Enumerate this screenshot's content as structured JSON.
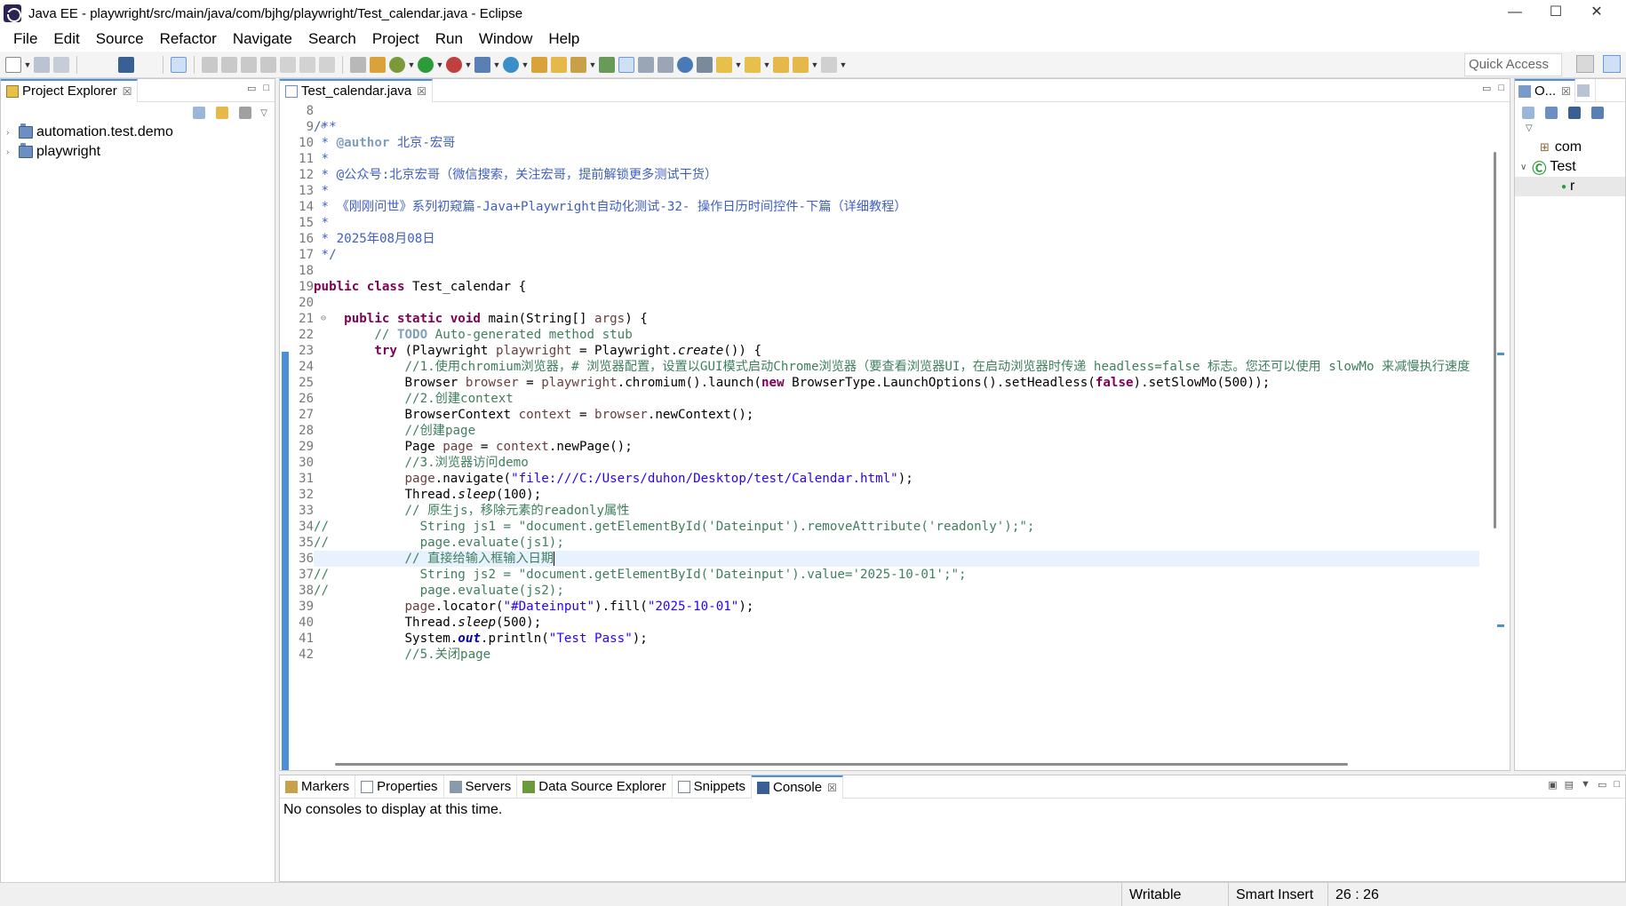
{
  "window": {
    "title": "Java EE - playwright/src/main/java/com/bjhg/playwright/Test_calendar.java - Eclipse",
    "controls": [
      "—",
      "☐",
      "✕"
    ]
  },
  "menu": [
    "File",
    "Edit",
    "Source",
    "Refactor",
    "Navigate",
    "Search",
    "Project",
    "Run",
    "Window",
    "Help"
  ],
  "toolbar": {
    "quick_access": "Quick Access"
  },
  "project_explorer": {
    "title": "Project Explorer",
    "close": "☒",
    "items": [
      {
        "label": "automation.test.demo"
      },
      {
        "label": "playwright"
      }
    ]
  },
  "editor": {
    "tab": "Test_calendar.java",
    "close": "☒",
    "line_numbers": [
      "8",
      "9",
      "10",
      "11",
      "12",
      "13",
      "14",
      "15",
      "16",
      "17",
      "18",
      "19",
      "20",
      "21",
      "22",
      "23",
      "24",
      "25",
      "26",
      "27",
      "28",
      "29",
      "30",
      "31",
      "32",
      "33",
      "34",
      "35",
      "36",
      "37",
      "38",
      "39",
      "40",
      "41",
      "42"
    ],
    "fold_markers": {
      "9": "⊖",
      "21": "⊖"
    },
    "text": {
      "l9": "/**",
      "l10_star": " * ",
      "l10_tag": "@author",
      "l10_rest": " 北京-宏哥",
      "l11": " *",
      "l12": " * @公众号:北京宏哥（微信搜索，关注宏哥，提前解锁更多测试干货）",
      "l13": " *",
      "l14": " * 《刚刚问世》系列初窥篇-Java+Playwright自动化测试-32- 操作日历时间控件-下篇（详细教程）",
      "l15": " *",
      "l16": " * 2025年08月08日",
      "l17": " */",
      "l19_kw": "public class",
      "l19_rest": " Test_calendar {",
      "l21_indent": "    ",
      "l21_kw": "public static void",
      "l21_rest": " main(String[] ",
      "l21_var": "args",
      "l21_end": ") {",
      "l22_indent": "        ",
      "l22_pre": "// ",
      "l22_todo": "TODO",
      "l22_rest": " Auto-generated method stub",
      "l23_indent": "        ",
      "l23_kw": "try",
      "l23_a": " (Playwright ",
      "l23_var": "playwright",
      "l23_b": " = Playwright.",
      "l23_m": "create",
      "l23_c": "()) {",
      "l24_indent": "            ",
      "l24": "//1.使用chromium浏览器，# 浏览器配置，设置以GUI模式启动Chrome浏览器（要查看浏览器UI，在启动浏览器时传递 headless=false 标志。您还可以使用 slowMo 来减慢执行速度",
      "l25_indent": "            ",
      "l25_a": "Browser ",
      "l25_var": "browser",
      "l25_b": " = ",
      "l25_var2": "playwright",
      "l25_c": ".chromium().launch(",
      "l25_kw": "new",
      "l25_d": " BrowserType.LaunchOptions().setHeadless(",
      "l25_kw2": "false",
      "l25_e": ").setSlowMo(500));",
      "l26_indent": "            ",
      "l26": "//2.创建context",
      "l27_indent": "            ",
      "l27_a": "BrowserContext ",
      "l27_var": "context",
      "l27_b": " = ",
      "l27_var2": "browser",
      "l27_c": ".newContext();",
      "l28_indent": "            ",
      "l28": "//创建page",
      "l29_indent": "            ",
      "l29_a": "Page ",
      "l29_var": "page",
      "l29_b": " = ",
      "l29_var2": "context",
      "l29_c": ".newPage();",
      "l30_indent": "            ",
      "l30": "//3.浏览器访问demo",
      "l31_indent": "            ",
      "l31_var": "page",
      "l31_a": ".navigate(",
      "l31_str": "\"file:///C:/Users/duhon/Desktop/test/Calendar.html\"",
      "l31_b": ");",
      "l32_indent": "            ",
      "l32_a": "Thread.",
      "l32_m": "sleep",
      "l32_b": "(100);",
      "l33_indent": "            ",
      "l33": "// 原生js，移除元素的readonly属性",
      "l34": "//            String js1 = \"document.getElementById('Dateinput').removeAttribute('readonly');\";",
      "l35": "//            page.evaluate(js1);",
      "l36_indent": "            ",
      "l36": "// 直接给输入框输入日期",
      "l37": "//            String js2 = \"document.getElementById('Dateinput').value='2025-10-01';\";",
      "l38": "//            page.evaluate(js2);",
      "l39_indent": "            ",
      "l39_var": "page",
      "l39_a": ".locator(",
      "l39_str": "\"#Dateinput\"",
      "l39_b": ").fill(",
      "l39_str2": "\"2025-10-01\"",
      "l39_c": ");",
      "l40_indent": "            ",
      "l40_a": "Thread.",
      "l40_m": "sleep",
      "l40_b": "(500);",
      "l41_indent": "            ",
      "l41_a": "System.",
      "l41_f": "out",
      "l41_b": ".println(",
      "l41_str": "\"Test Pass\"",
      "l41_c": ");",
      "l42_indent": "            ",
      "l42": "//5.关闭page"
    }
  },
  "outline": {
    "title": "O...",
    "close": "☒",
    "items": [
      {
        "label": "com"
      },
      {
        "label": "Test"
      },
      {
        "label": "r"
      }
    ]
  },
  "bottom_tabs": [
    {
      "label": "Markers"
    },
    {
      "label": "Properties"
    },
    {
      "label": "Servers"
    },
    {
      "label": "Data Source Explorer"
    },
    {
      "label": "Snippets"
    },
    {
      "label": "Console",
      "close": "☒"
    }
  ],
  "console": {
    "message": "No consoles to display at this time."
  },
  "status": {
    "writable": "Writable",
    "insert_mode": "Smart Insert",
    "position": "26 : 26"
  },
  "colors": {
    "keyword": "#7f0055",
    "comment": "#3f7f5f",
    "javadoc": "#3f5fbf",
    "string": "#2a00ff",
    "variable": "#6a3e3e",
    "accent": "#4a8fd8"
  }
}
